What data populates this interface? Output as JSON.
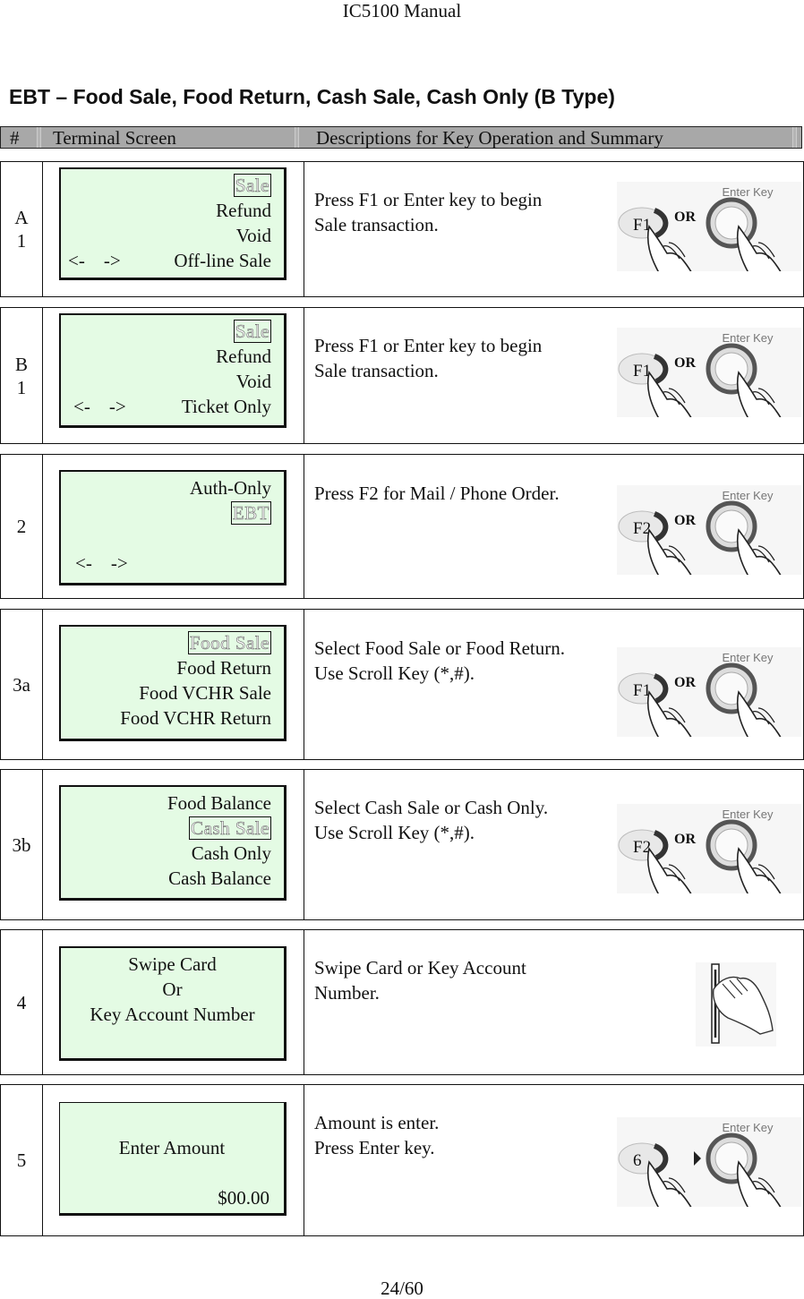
{
  "header": {
    "running_title": "IC5100 Manual"
  },
  "section_title": "EBT – Food Sale, Food Return, Cash Sale, Cash Only (B Type)",
  "table": {
    "columns": [
      "#",
      "Terminal Screen",
      "Descriptions for Key Operation and Summary"
    ],
    "rows": [
      {
        "id": "A\n1",
        "screen": {
          "selected": "Sale",
          "lines": [
            "Refund",
            "Void"
          ],
          "nav": "<-    ->",
          "last": "Off-line Sale"
        },
        "description": "Press F1 or Enter key to begin\nSale transaction.",
        "key_image": {
          "key": "F1",
          "joiner": "OR",
          "label": "Enter Key"
        }
      },
      {
        "id": "B\n1",
        "screen": {
          "selected": "Sale",
          "lines": [
            "Refund",
            "Void"
          ],
          "nav": "<-    ->",
          "last": "Ticket Only"
        },
        "description": "Press F1 or Enter key to begin\nSale transaction.",
        "key_image": {
          "key": "F1",
          "joiner": "OR",
          "label": "Enter Key"
        }
      },
      {
        "id": "2",
        "screen": {
          "first": "Auth-Only",
          "selected": "EBT",
          "nav": "<-    ->"
        },
        "description": "Press F2 for Mail / Phone Order.",
        "key_image": {
          "key": "F2",
          "joiner": "OR",
          "label": "Enter Key"
        }
      },
      {
        "id": "3a",
        "screen": {
          "selected": "Food Sale",
          "lines": [
            "Food Return",
            "Food VCHR Sale",
            "Food VCHR Return"
          ]
        },
        "description": "Select Food Sale or Food Return.\nUse Scroll Key (*,#).",
        "key_image": {
          "key": "F1",
          "joiner": "OR",
          "label": "Enter Key"
        }
      },
      {
        "id": "3b",
        "screen": {
          "first": "Food Balance",
          "selected": "Cash Sale",
          "lines": [
            "Cash Only",
            "Cash Balance"
          ]
        },
        "description": "Select Cash Sale or Cash Only.\nUse Scroll Key (*,#).",
        "key_image": {
          "key": "F2",
          "joiner": "OR",
          "label": "Enter Key"
        }
      },
      {
        "id": "4",
        "screen": {
          "lines": [
            "Swipe Card",
            "Or",
            "Key Account Number"
          ]
        },
        "description": "Swipe Card or Key Account\nNumber.",
        "key_image": {
          "type": "card-swipe"
        }
      },
      {
        "id": "5",
        "screen": {
          "title": "Enter Amount",
          "amount": "$00.00"
        },
        "description": "Amount is enter.\nPress Enter key.",
        "key_image": {
          "key": "6",
          "joiner": "arrow",
          "label": "Enter Key"
        }
      }
    ]
  },
  "footer": {
    "page": "24/60"
  }
}
